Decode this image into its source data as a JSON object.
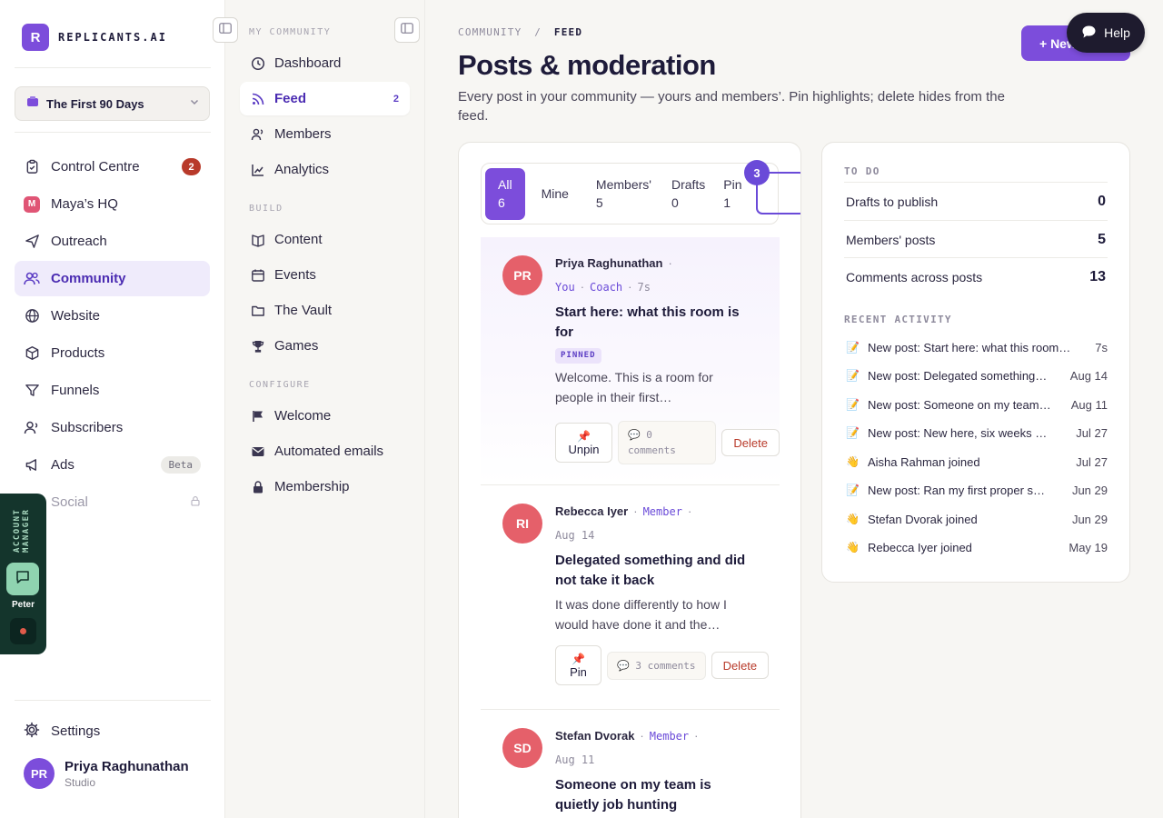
{
  "brand": {
    "logo_letter": "R",
    "name": "REPLICANTS.AI"
  },
  "workspace": {
    "label": "The First 90 Days"
  },
  "nav": [
    {
      "label": "Control Centre",
      "icon": "clipboard-icon",
      "badge": "2"
    },
    {
      "label": "Maya’s HQ",
      "icon": "maya-logo-icon",
      "logo_letter": "M"
    },
    {
      "label": "Outreach",
      "icon": "send-icon"
    },
    {
      "label": "Community",
      "icon": "users-icon",
      "active": true
    },
    {
      "label": "Website",
      "icon": "globe-icon"
    },
    {
      "label": "Products",
      "icon": "box-icon"
    },
    {
      "label": "Funnels",
      "icon": "funnel-icon"
    },
    {
      "label": "Subscribers",
      "icon": "subscribers-icon"
    },
    {
      "label": "Ads",
      "icon": "megaphone-icon",
      "badge": "Beta"
    },
    {
      "label": "Social",
      "icon": "social-icon",
      "locked": true
    }
  ],
  "settings_label": "Settings",
  "user": {
    "initials": "PR",
    "name": "Priya Raghunathan",
    "plan": "Studio"
  },
  "account_manager": {
    "label": "ACCOUNT MANAGER",
    "name": "Peter"
  },
  "subnav": {
    "section_my": "MY COMMUNITY",
    "section_build": "BUILD",
    "section_configure": "CONFIGURE",
    "my": [
      {
        "label": "Dashboard",
        "icon": "clock-icon"
      },
      {
        "label": "Feed",
        "icon": "rss-icon",
        "count": "2",
        "active": true
      },
      {
        "label": "Members",
        "icon": "members-icon"
      },
      {
        "label": "Analytics",
        "icon": "analytics-icon"
      }
    ],
    "build": [
      {
        "label": "Content",
        "icon": "content-icon"
      },
      {
        "label": "Events",
        "icon": "calendar-icon"
      },
      {
        "label": "The Vault",
        "icon": "folder-icon"
      },
      {
        "label": "Games",
        "icon": "trophy-icon"
      }
    ],
    "configure": [
      {
        "label": "Welcome",
        "icon": "welcome-icon"
      },
      {
        "label": "Automated emails",
        "icon": "mail-icon"
      },
      {
        "label": "Membership",
        "icon": "lock-icon"
      }
    ]
  },
  "breadcrumb": {
    "parent": "COMMUNITY",
    "sep": "/",
    "current": "FEED"
  },
  "page": {
    "title": "Posts & moderation",
    "description": "Every post in your community — yours and members’. Pin highlights; delete hides from the feed.",
    "new_button": "+ New",
    "help_button": "Help"
  },
  "tabs": [
    {
      "label": "All",
      "count": "6",
      "active": true
    },
    {
      "label": "Mine",
      "count": ""
    },
    {
      "label": "Members'",
      "count": "5"
    },
    {
      "label": "Drafts",
      "count": "0"
    },
    {
      "label": "Pin",
      "count": "1"
    }
  ],
  "tab_highlight_badge": "3",
  "posts": [
    {
      "initials": "PR",
      "author": "Priya Raghunathan",
      "tag1": "You",
      "tag2": "Coach",
      "time": "7s",
      "title": "Start here: what this room is for",
      "pinned_tag": "PINNED",
      "excerpt": "Welcome. This is a room for people in their first…",
      "pin_action": "Unpin",
      "comments": "0 comments",
      "delete": "Delete"
    },
    {
      "initials": "RI",
      "author": "Rebecca Iyer",
      "role": "Member",
      "time": "Aug 14",
      "title": "Delegated something and did not take it back",
      "excerpt": "It was done differently to how I would have done it and the…",
      "pin_action": "Pin",
      "comments": "3 comments",
      "delete": "Delete"
    },
    {
      "initials": "SD",
      "author": "Stefan Dvorak",
      "role": "Member",
      "time": "Aug 11",
      "title": "Someone on my team is quietly job hunting"
    }
  ],
  "todo": {
    "heading": "TO DO",
    "rows": [
      {
        "label": "Drafts to publish",
        "value": "0"
      },
      {
        "label": "Members' posts",
        "value": "5"
      },
      {
        "label": "Comments across posts",
        "value": "13"
      }
    ]
  },
  "activity": {
    "heading": "RECENT ACTIVITY",
    "rows": [
      {
        "emoji": "📝",
        "text": "New post: Start here: what this room…",
        "when": "7s"
      },
      {
        "emoji": "📝",
        "text": "New post: Delegated something…",
        "when": "Aug 14"
      },
      {
        "emoji": "📝",
        "text": "New post: Someone on my team…",
        "when": "Aug 11"
      },
      {
        "emoji": "📝",
        "text": "New post: New here, six weeks …",
        "when": "Jul 27"
      },
      {
        "emoji": "👋",
        "text": "Aisha Rahman joined",
        "when": "Jul 27"
      },
      {
        "emoji": "📝",
        "text": "New post: Ran my first proper s…",
        "when": "Jun 29"
      },
      {
        "emoji": "👋",
        "text": "Stefan Dvorak joined",
        "when": "Jun 29"
      },
      {
        "emoji": "👋",
        "text": "Rebecca Iyer joined",
        "when": "May 19"
      }
    ]
  },
  "colors": {
    "accent": "#7c4ddb",
    "danger": "#b83a2a",
    "avatar": "#e5606a",
    "manager_panel": "#14352c"
  }
}
